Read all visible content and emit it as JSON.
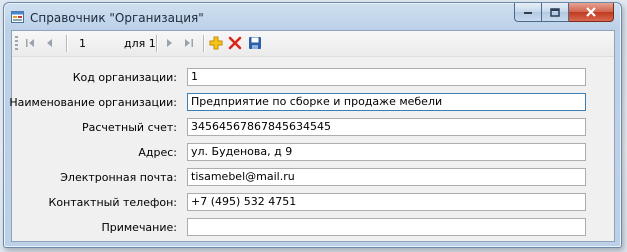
{
  "window": {
    "title": "Справочник \"Организация\""
  },
  "navigator": {
    "position": "1",
    "of_label": "для 1"
  },
  "fields": [
    {
      "label": "Код организации:",
      "value": "1"
    },
    {
      "label": "Наименование организации:",
      "value": "Предприятие по сборке и продаже мебели"
    },
    {
      "label": "Расчетный счет:",
      "value": "34564567867845634545"
    },
    {
      "label": "Адрес:",
      "value": "ул. Буденова, д 9"
    },
    {
      "label": "Электронная почта:",
      "value": "tisamebel@mail.ru"
    },
    {
      "label": "Контактный телефон:",
      "value": "+7 (495) 532 4751"
    },
    {
      "label": "Примечание:",
      "value": ""
    }
  ],
  "colors": {
    "add": "#e8a000",
    "delete": "#d9261c",
    "save": "#2b5fa8"
  },
  "icons": [
    "move-first-icon",
    "move-previous-icon",
    "move-next-icon",
    "move-last-icon",
    "add-new-icon",
    "delete-icon",
    "save-icon"
  ]
}
